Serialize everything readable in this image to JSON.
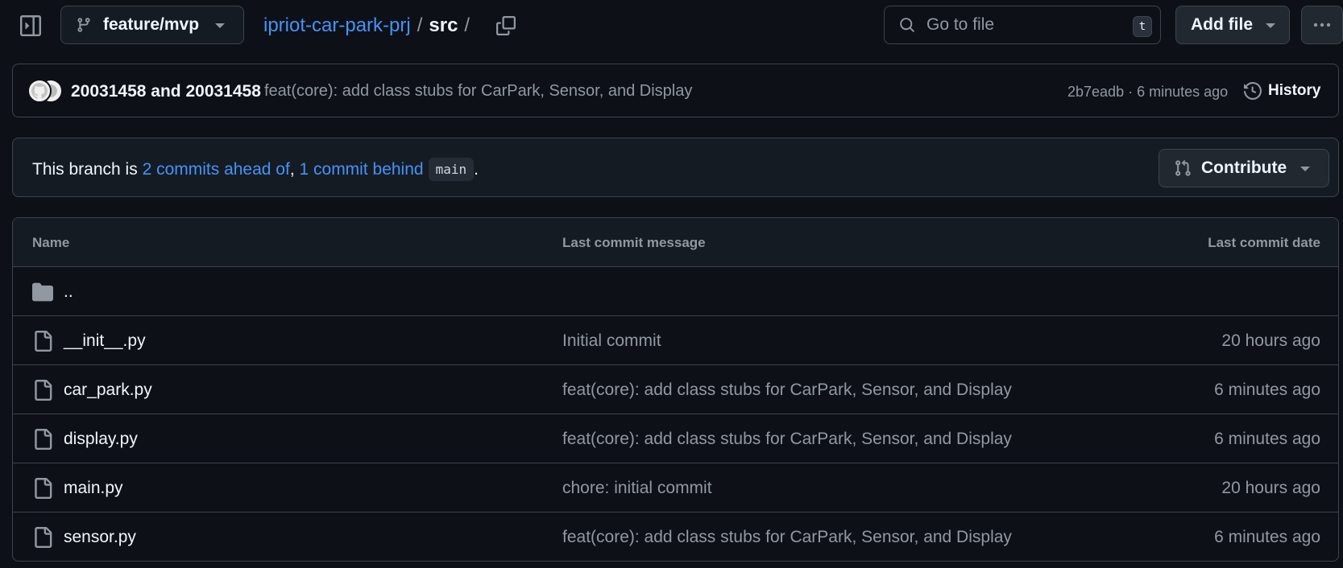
{
  "header": {
    "branch": "feature/mvp",
    "breadcrumb": {
      "repo": "ipriot-car-park-prj",
      "sep1": "/",
      "current": "src",
      "sep2": "/"
    },
    "search": {
      "placeholder": "Go to file",
      "shortcut": "t"
    },
    "add_file_label": "Add file"
  },
  "commit": {
    "author1": "20031458",
    "and": "and",
    "author2": "20031458",
    "message": "feat(core): add class stubs for CarPark, Sensor, and Display",
    "meta": "2b7eadb · 6 minutes ago",
    "history_label": "History"
  },
  "branch_status": {
    "prefix": "This branch is ",
    "ahead": "2 commits ahead of",
    "comma": ", ",
    "behind": "1 commit behind",
    "base": "main",
    "suffix": ".",
    "contribute_label": "Contribute"
  },
  "table": {
    "headers": {
      "name": "Name",
      "message": "Last commit message",
      "date": "Last commit date"
    },
    "rows": [
      {
        "icon": "folder-icon",
        "name": "..",
        "message": "",
        "date": ""
      },
      {
        "icon": "file-icon",
        "name": "__init__.py",
        "message": "Initial commit",
        "date": "20 hours ago"
      },
      {
        "icon": "file-icon",
        "name": "car_park.py",
        "message": "feat(core): add class stubs for CarPark, Sensor, and Display",
        "date": "6 minutes ago"
      },
      {
        "icon": "file-icon",
        "name": "display.py",
        "message": "feat(core): add class stubs for CarPark, Sensor, and Display",
        "date": "6 minutes ago"
      },
      {
        "icon": "file-icon",
        "name": "main.py",
        "message": "chore: initial commit",
        "date": "20 hours ago"
      },
      {
        "icon": "file-icon",
        "name": "sensor.py",
        "message": "feat(core): add class stubs for CarPark, Sensor, and Display",
        "date": "6 minutes ago"
      }
    ]
  },
  "colors": {
    "background": "#0d1117",
    "link": "#4493f8",
    "border": "#3d444d",
    "muted": "#9198a1"
  }
}
